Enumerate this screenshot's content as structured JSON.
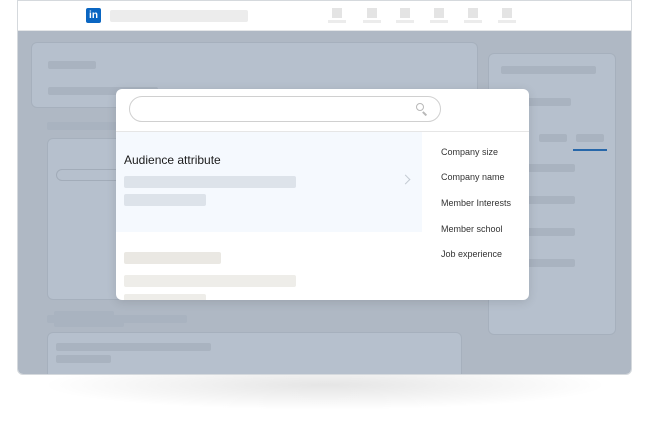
{
  "colors": {
    "brand": "#0a66c2",
    "overlay": "#506987",
    "highlight_row": "#f5f9fe"
  },
  "header": {
    "logo_text": "in"
  },
  "modal": {
    "search_placeholder": "",
    "attribute_card": {
      "title": "Audience attribute"
    },
    "options": [
      "Company size",
      "Company name",
      "Member Interests",
      "Member school",
      "Job experience"
    ]
  },
  "icons": {
    "logo": "linkedin-logo",
    "search": "search-icon",
    "chevron": "chevron-right-icon"
  }
}
